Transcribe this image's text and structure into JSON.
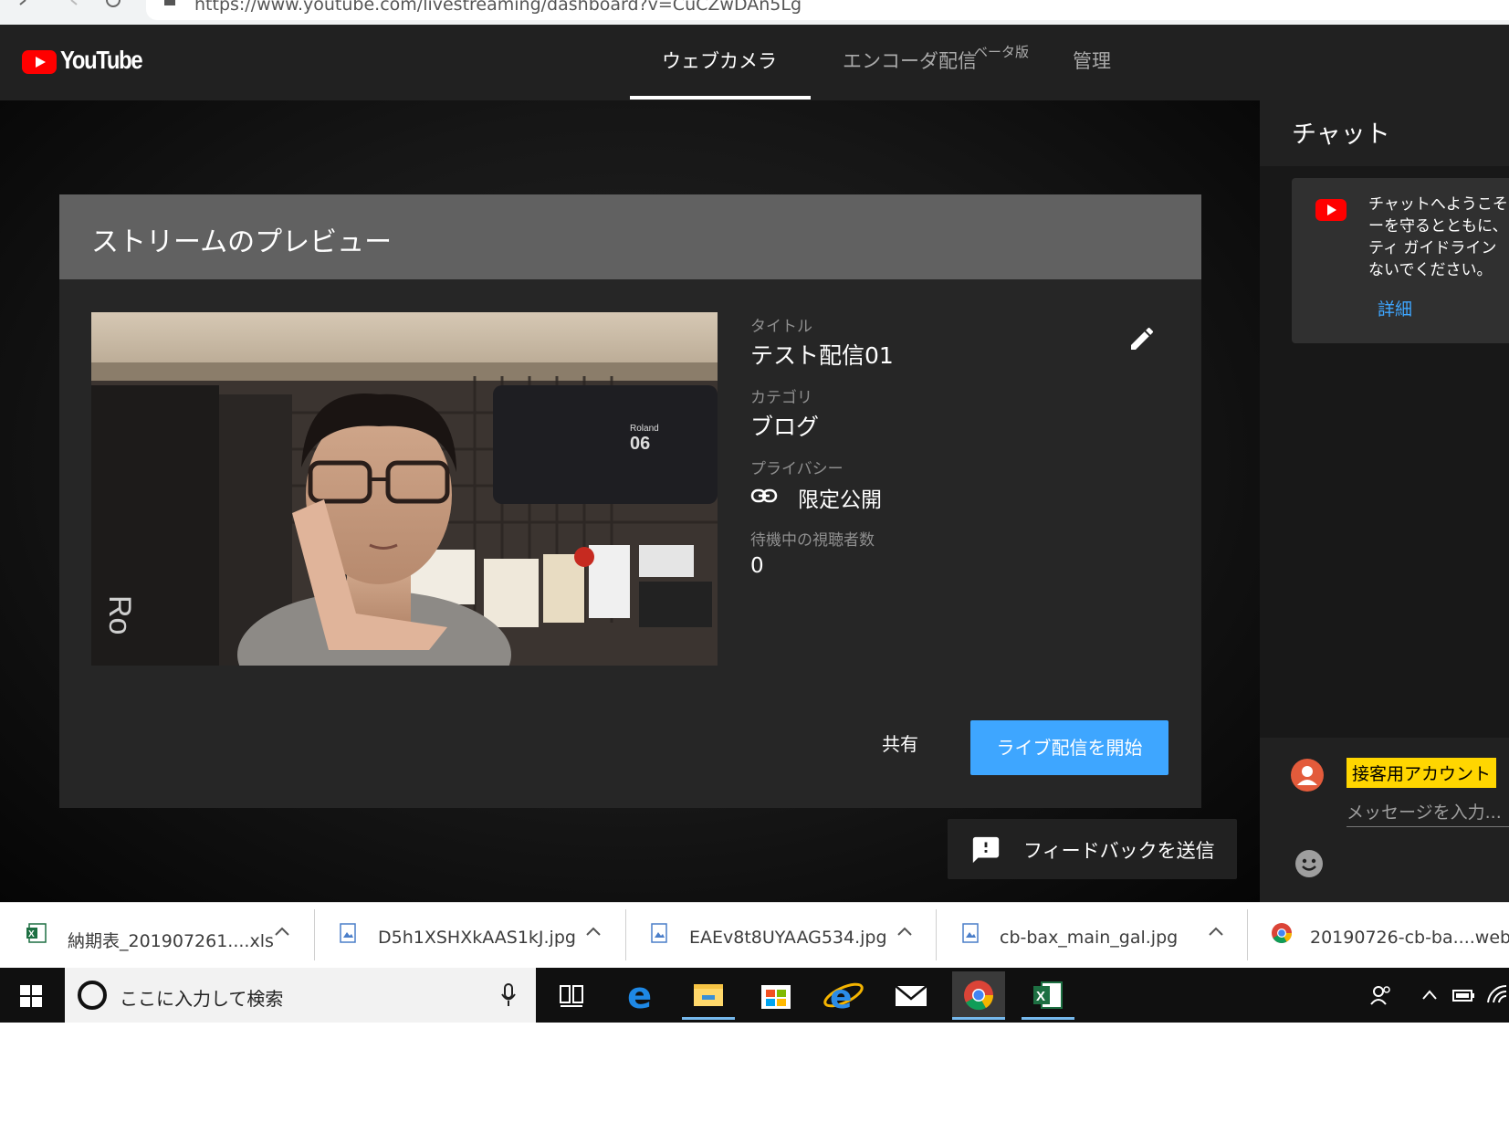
{
  "browser": {
    "url": "https://www.youtube.com/livestreaming/dashboard?v=CuCZwDAn5Lg"
  },
  "header": {
    "logo_text": "YouTube",
    "tabs": [
      {
        "label": "ウェブカメラ",
        "active": true
      },
      {
        "label": "エンコーダ配信",
        "badge": "ベータ版"
      },
      {
        "label": "管理"
      }
    ]
  },
  "preview": {
    "heading": "ストリームのプレビュー",
    "title_label": "タイトル",
    "title_value": "テスト配信01",
    "category_label": "カテゴリ",
    "category_value": "ブログ",
    "privacy_label": "プライバシー",
    "privacy_value": "限定公開",
    "viewers_label": "待機中の視聴者数",
    "viewers_value": "0",
    "share_label": "共有",
    "go_live_label": "ライブ配信を開始"
  },
  "feedback": {
    "label": "フィードバックを送信"
  },
  "chat": {
    "title": "チャット",
    "welcome": "チャットへようこそ\nーを守るとともに、\nティ ガイドライン\nないでください。",
    "details_link": "詳細",
    "username": "接客用アカウント",
    "input_placeholder": "メッセージを入力..."
  },
  "downloads": [
    {
      "name": "納期表_201907261....xls",
      "type": "excel"
    },
    {
      "name": "D5h1XSHXkAAS1kJ.jpg",
      "type": "image"
    },
    {
      "name": "EAEv8t8UYAAG534.jpg",
      "type": "image"
    },
    {
      "name": "cb-bax_main_gal.jpg",
      "type": "image"
    },
    {
      "name": "20190726-cb-ba....webp",
      "type": "chrome"
    }
  ],
  "taskbar": {
    "search_placeholder": "ここに入力して検索",
    "apps": [
      "task-view",
      "edge",
      "file-explorer",
      "store",
      "internet-explorer",
      "mail",
      "chrome",
      "excel"
    ]
  },
  "colors": {
    "accent_blue": "#3ea6ff",
    "youtube_red": "#ff0000",
    "username_badge": "#ffd600"
  }
}
